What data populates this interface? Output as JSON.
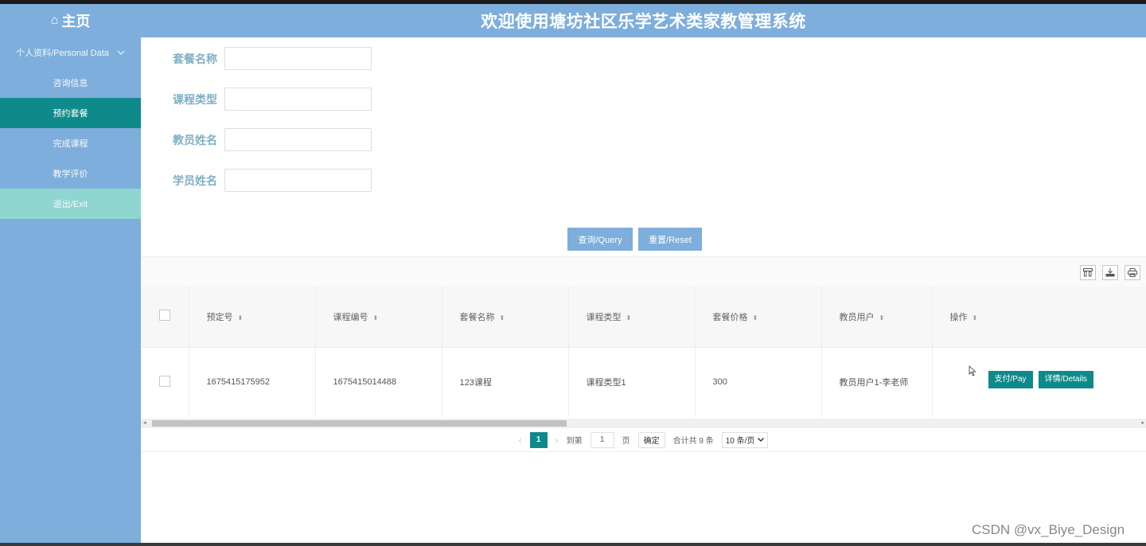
{
  "header": {
    "home_icon": "home-icon",
    "home_label": "主页",
    "system_title": "欢迎使用塘坊社区乐学艺术类家教管理系统"
  },
  "sidebar": {
    "group_label": "个人资料/Personal Data",
    "items": [
      {
        "label": "咨询信息",
        "active": false
      },
      {
        "label": "预约套餐",
        "active": true
      },
      {
        "label": "完成课程",
        "active": false
      },
      {
        "label": "教学评价",
        "active": false
      },
      {
        "label": "退出/Exit",
        "active": false
      }
    ]
  },
  "search": {
    "fields": [
      {
        "label": "套餐名称",
        "value": ""
      },
      {
        "label": "课程类型",
        "value": ""
      },
      {
        "label": "教员姓名",
        "value": ""
      },
      {
        "label": "学员姓名",
        "value": ""
      }
    ],
    "query_label": "查询/Query",
    "reset_label": "重置/Reset"
  },
  "toolbar": {
    "icons": [
      "columns-icon",
      "export-icon",
      "print-icon"
    ]
  },
  "table": {
    "columns": [
      "预定号",
      "课程编号",
      "套餐名称",
      "课程类型",
      "套餐价格",
      "教员用户",
      "操作"
    ],
    "rows": [
      {
        "cells": [
          "1675415175952",
          "1675415014488",
          "123课程",
          "课程类型1",
          "300",
          "教员用户1-李老师"
        ],
        "actions": [
          "支付/Pay",
          "详情/Details"
        ]
      }
    ]
  },
  "pagination": {
    "current_page": "1",
    "goto_label": "到第",
    "goto_value": "1",
    "page_suffix": "页",
    "confirm_label": "确定",
    "total_label": "合计共 9 条",
    "page_size_label": "10 条/页"
  },
  "watermark": "CSDN @vx_Biye_Design",
  "colors": {
    "header_bg": "#7eaedb",
    "accent_teal": "#0e8a8a",
    "exit_bg": "#8fd6d0"
  }
}
